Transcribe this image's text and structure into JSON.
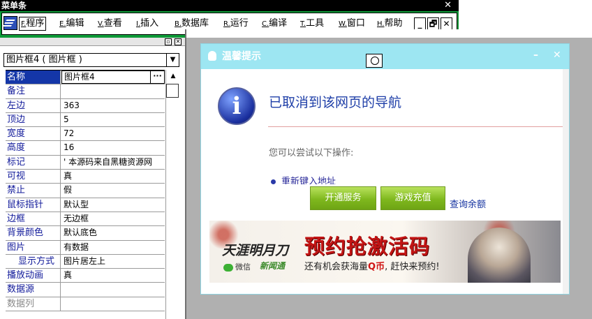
{
  "menu_window": {
    "title": "菜单条",
    "close": "✕",
    "menu": [
      {
        "key": "F.",
        "label": "程序"
      },
      {
        "key": "E.",
        "label": "编辑"
      },
      {
        "key": "V.",
        "label": "查看"
      },
      {
        "key": "I.",
        "label": "插入"
      },
      {
        "key": "B.",
        "label": "数据库"
      },
      {
        "key": "R.",
        "label": "运行"
      },
      {
        "key": "C.",
        "label": "编译"
      },
      {
        "key": "T.",
        "label": "工具"
      },
      {
        "key": "W.",
        "label": "窗口"
      },
      {
        "key": "H.",
        "label": "帮助"
      }
    ],
    "controls": {
      "minimize": "_",
      "restore": "🗗",
      "close": "✕"
    }
  },
  "property_panel": {
    "pin": "▫",
    "close": "✕",
    "object_selector": "图片框4 ( 图片框 )",
    "dropdown_arrow": "▼",
    "scroll_up": "▲",
    "rows": [
      {
        "name": "名称",
        "value": "图片框4",
        "button": "···"
      },
      {
        "name": "备注",
        "value": ""
      },
      {
        "name": "左边",
        "value": "363"
      },
      {
        "name": "顶边",
        "value": "5"
      },
      {
        "name": "宽度",
        "value": "72"
      },
      {
        "name": "高度",
        "value": "16"
      },
      {
        "name": "标记",
        "value": "' 本源码来自黑糖资源网"
      },
      {
        "name": "可视",
        "value": "真"
      },
      {
        "name": "禁止",
        "value": "假"
      },
      {
        "name": "鼠标指针",
        "value": "默认型"
      },
      {
        "name": "边框",
        "value": "无边框"
      },
      {
        "name": "背景颜色",
        "value": "默认底色"
      },
      {
        "name": "图片",
        "value": "有数据"
      },
      {
        "name": "显示方式",
        "value": "图片居左上"
      },
      {
        "name": "播放动画",
        "value": "真"
      },
      {
        "name": "数据源",
        "value": ""
      },
      {
        "name": "数据列",
        "value": ""
      }
    ]
  },
  "dialog": {
    "title": "温馨提示",
    "minimize": "–",
    "close": "✕",
    "info_glyph": "i",
    "heading": "已取消到该网页的导航",
    "try_text": "您可以尝试以下操作:",
    "bullet_text": "重新键入地址",
    "open_service_btn": "开通服务",
    "recharge_btn": "游戏充值",
    "query_balance_link": "查询余额",
    "banner": {
      "logo": "天涯明月刀",
      "wechat": "微信",
      "brand2": "新闻通",
      "headline": "预约抢激活码",
      "subline_prefix": "还有机会获海量",
      "subline_highlight": "Q币",
      "subline_suffix": ", 赶快来预约!"
    }
  },
  "colors": {
    "menu_frame": "#0e9a38",
    "selected_row": "#1436a8",
    "dialog_title": "#9de6f2",
    "heading_blue": "#1f3fa8",
    "button_green": "#7fb81e",
    "banner_red": "#c21414"
  }
}
